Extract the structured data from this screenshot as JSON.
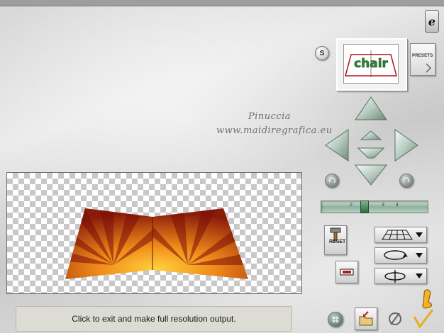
{
  "status": {
    "message": "Click to exit and make full resolution output."
  },
  "watermark": {
    "line1": "Pinuccia",
    "line2": "www.maidiregrafica.eu"
  },
  "controls": {
    "presets_label": "PRESETS",
    "reset_label": "RESET",
    "s_label": "S",
    "zoom_ticks": [
      "2",
      "3",
      "4"
    ]
  },
  "preview": {
    "logo_text": "chair"
  },
  "colors": {
    "background": "#d9d9d9",
    "status_bg": "#dcdcd4",
    "slider": "#8fb09e"
  }
}
